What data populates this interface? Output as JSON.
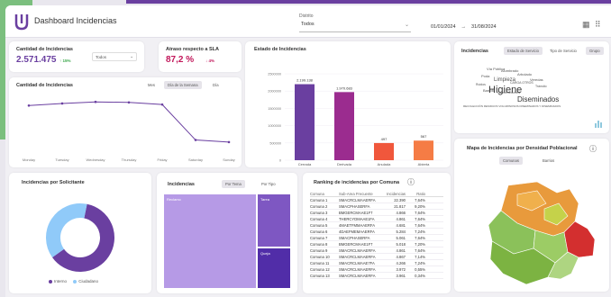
{
  "header": {
    "title": "Dashboard Incidencias",
    "filter_label": "Distrito",
    "filter_value": "Todos",
    "date_from": "01/01/2024",
    "date_sep": "→",
    "date_to": "31/08/2024"
  },
  "kpi_total": {
    "title": "Cantidad de Incidencias",
    "value": "2.571.475",
    "delta": "↑ 15%",
    "select": "Todos"
  },
  "kpi_sla": {
    "title": "Atraso respecto a SLA",
    "value": "87,2 %",
    "delta": "↓ 4%"
  },
  "line_card": {
    "title": "Cantidad de Incidencias",
    "tabs": [
      "Mes",
      "Día de la Semana",
      "Día"
    ]
  },
  "estado_card": {
    "title": "Estado de Incidencias"
  },
  "solicitante_card": {
    "title": "Incidencias por Solicitante",
    "legend": [
      "Interno",
      "Ciudadano"
    ]
  },
  "treemap_card": {
    "title": "Incidencias",
    "tabs": [
      "Por Tema",
      "Por Tipo"
    ],
    "labels": [
      "Reclamo",
      "Tarea",
      "Queja"
    ]
  },
  "ranking_card": {
    "title": "Ranking de incidencias por Comuna",
    "info_icon": "ⓘ",
    "columns": [
      "Comuna",
      "Sub-Area Frecuente",
      "Incidencias",
      "Ratio"
    ],
    "rows": [
      [
        "Comuna 1",
        "SMACRCLMAAERFA",
        "22.390",
        "7,64%"
      ],
      [
        "Comuna 2",
        "SMACPHASERFA",
        "21.817",
        "9,20%"
      ],
      [
        "Comuna 3",
        "BMGERCMAAE1F7",
        "4.866",
        "7,64%"
      ],
      [
        "Comuna 4",
        "THERCYDMAAE1FA",
        "4.861",
        "7,64%"
      ],
      [
        "Comuna 5",
        "4MAETFMMAAERFA",
        "4.681",
        "7,64%"
      ],
      [
        "Comuna 6",
        "4DAEFMEMAAERFA",
        "5.284",
        "7,24%"
      ],
      [
        "Comuna 7",
        "SMACPHASERFA",
        "5.061",
        "7,64%"
      ],
      [
        "Comuna 8",
        "BMGERCMAAE1F7",
        "5.018",
        "7,20%"
      ],
      [
        "Comuna 9",
        "SMACRCLMAAERFA",
        "4.861",
        "7,64%"
      ],
      [
        "Comuna 10",
        "SMACRCLMAAERFA",
        "4.867",
        "7,14%"
      ],
      [
        "Comuna 11",
        "SMACRCLMAAE7FA",
        "4.266",
        "7,24%"
      ],
      [
        "Comuna 12",
        "SMACRCLMAAERFA",
        "3.972",
        "0,55%"
      ],
      [
        "Comuna 13",
        "SMACRCLMAAERFA",
        "3.961",
        "0,34%"
      ]
    ]
  },
  "wordcloud_card": {
    "title": "Incidencias",
    "tabs": [
      "Estado de Servicio",
      "Tipo de Servicio",
      "Grupo"
    ],
    "words": [
      {
        "text": "Higiene",
        "size": 11
      },
      {
        "text": "Diseminados",
        "size": 8
      },
      {
        "text": "Limpieza",
        "size": 6
      },
      {
        "text": "Vía Pública",
        "size": 4
      },
      {
        "text": "Alumbrado",
        "size": 4
      },
      {
        "text": "Arbolado",
        "size": 4
      },
      {
        "text": "Veredas",
        "size": 4
      },
      {
        "text": "Contenedores",
        "size": 4
      },
      {
        "text": "Barrido",
        "size": 4
      },
      {
        "text": "Poda",
        "size": 4
      },
      {
        "text": "Ruidos",
        "size": 3.5
      },
      {
        "text": "Tránsito",
        "size": 3.5
      },
      {
        "text": "CARGA OTROS",
        "size": 3.5
      },
      {
        "text": "RECOLECCIÓN RESIDUOS VOLUMINOSOS DISEMINADOS Y DISEMINADOS",
        "size": 3
      }
    ]
  },
  "map_card": {
    "title": "Mapa de Incidencias por Densidad Poblacional",
    "info_icon": "ⓘ",
    "tabs": [
      "Comunas",
      "Barrios"
    ]
  },
  "colors": {
    "brand": "#6a3fa0",
    "kpi_green": "#3aa64a",
    "kpi_red": "#c2185b",
    "bar_purple": "#6a3fa0",
    "bar_magenta": "#9b2c8f",
    "bar_orange_red": "#f0573c",
    "bar_orange": "#f57c45"
  },
  "chart_data": [
    {
      "type": "line",
      "title": "Cantidad de Incidencias",
      "categories": [
        "Monday",
        "Tuesday",
        "Wednesday",
        "Thursday",
        "Friday",
        "Saturday",
        "Sunday"
      ],
      "values": [
        420000,
        440000,
        455000,
        450000,
        430000,
        90000,
        70000
      ],
      "ylim": [
        0,
        500000
      ]
    },
    {
      "type": "bar",
      "title": "Estado de Incidencias",
      "categories": [
        "Cerrada",
        "Derivada",
        "Anulada",
        "Abierta"
      ],
      "values": [
        2199138,
        1970683,
        497000,
        567000
      ],
      "data_labels": [
        "2.199.138",
        "1.970.683",
        "497",
        "567"
      ],
      "y_ticks": [
        "2500000",
        "2000000",
        "1500000",
        "1000000",
        "500000",
        "0"
      ],
      "ylim": [
        0,
        2500000
      ]
    },
    {
      "type": "pie",
      "title": "Incidencias por Solicitante",
      "categories": [
        "Interno",
        "Ciudadano"
      ],
      "values": [
        62,
        38
      ]
    }
  ]
}
